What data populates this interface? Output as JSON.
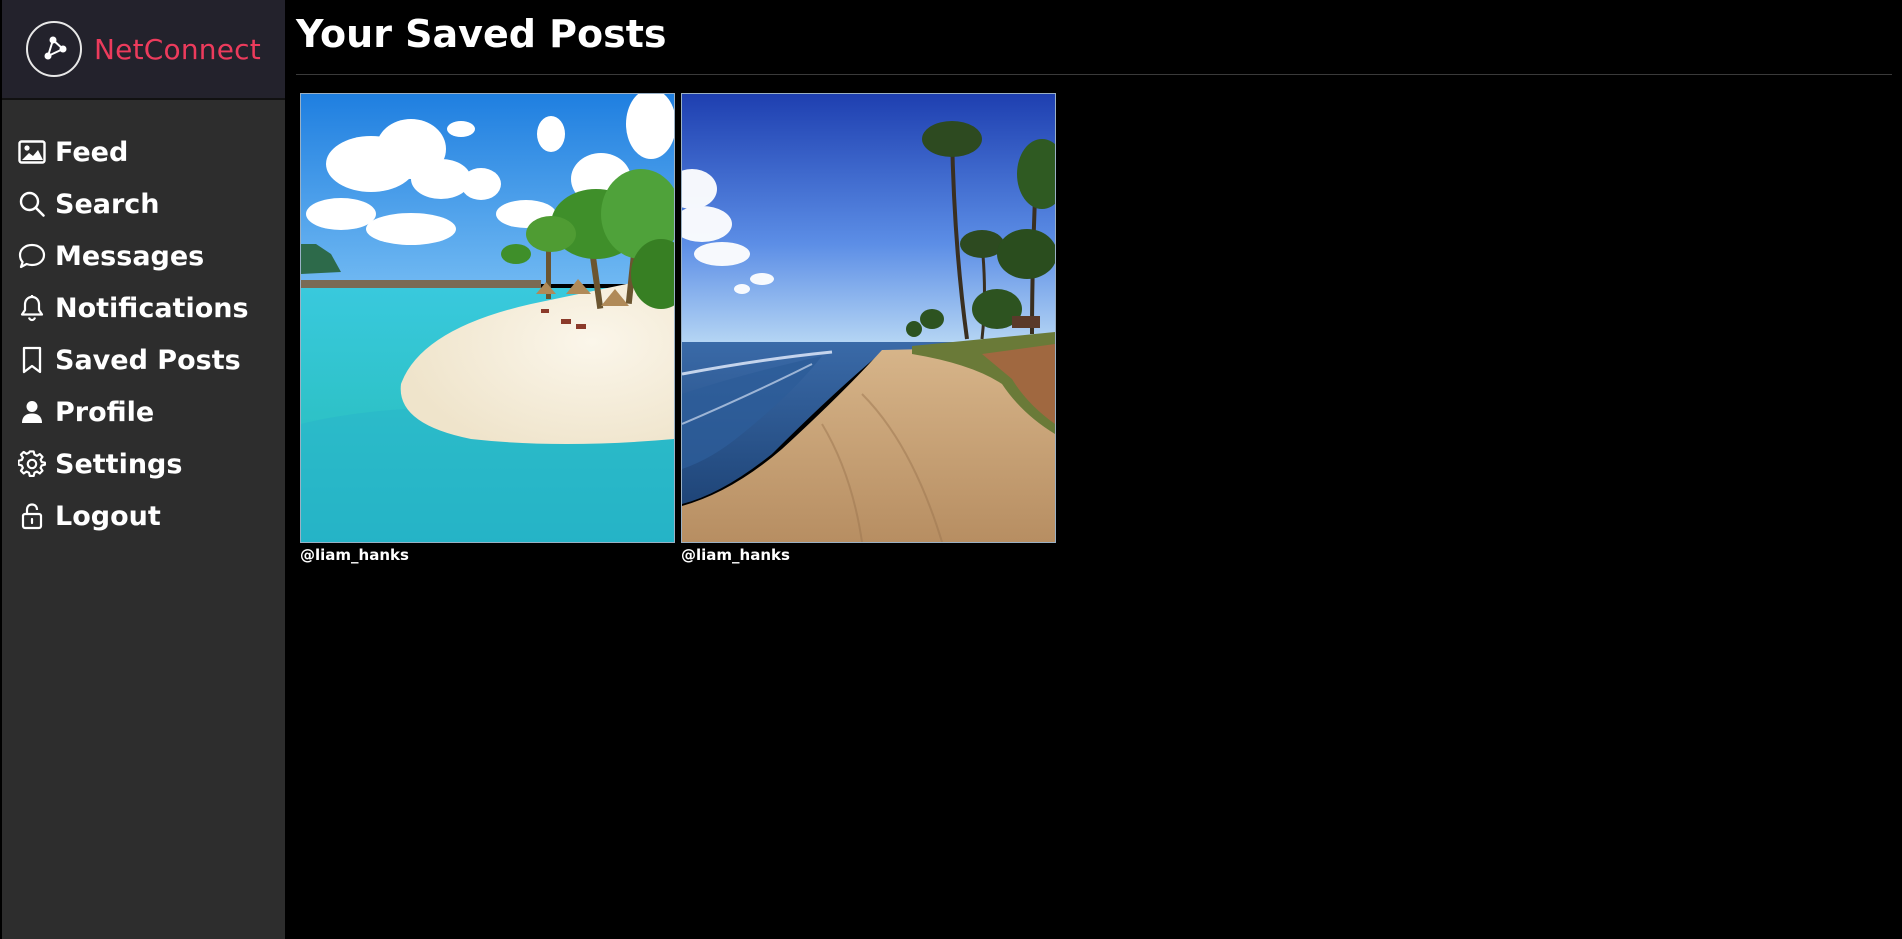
{
  "app": {
    "name": "NetConnect",
    "brand_color": "#ec3b5c"
  },
  "sidebar": {
    "items": [
      {
        "label": "Feed",
        "icon": "image-icon"
      },
      {
        "label": "Search",
        "icon": "search-icon"
      },
      {
        "label": "Messages",
        "icon": "chat-bubble-icon"
      },
      {
        "label": "Notifications",
        "icon": "bell-icon"
      },
      {
        "label": "Saved Posts",
        "icon": "bookmark-icon"
      },
      {
        "label": "Profile",
        "icon": "person-icon"
      },
      {
        "label": "Settings",
        "icon": "gear-icon"
      },
      {
        "label": "Logout",
        "icon": "lock-icon"
      }
    ]
  },
  "main": {
    "title": "Your Saved Posts",
    "posts": [
      {
        "author": "@liam_hanks",
        "image": "tropical-lagoon-beach-photo"
      },
      {
        "author": "@liam_hanks",
        "image": "sandy-beach-palm-trees-photo"
      }
    ]
  }
}
